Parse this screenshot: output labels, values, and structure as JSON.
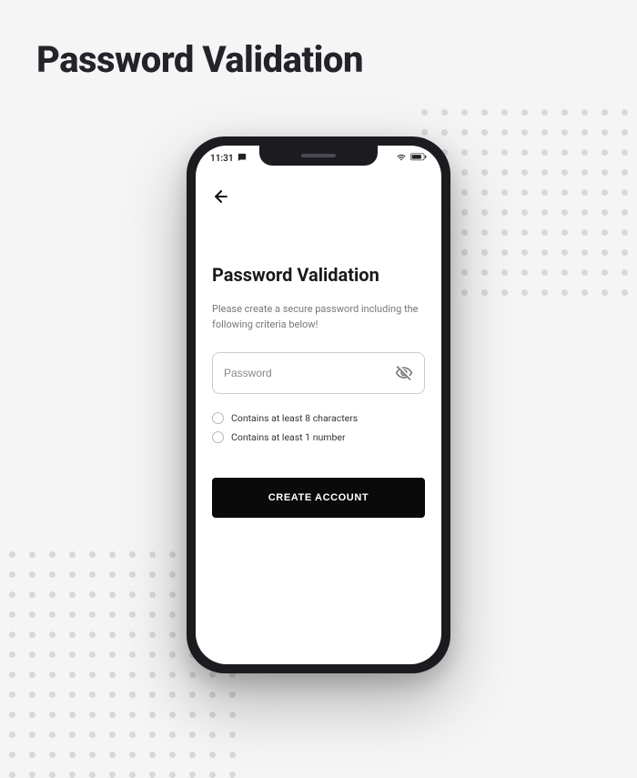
{
  "page": {
    "title": "Password Validation"
  },
  "status_bar": {
    "time": "11:31",
    "sms_icon": "sms"
  },
  "screen": {
    "heading": "Password Validation",
    "subtext": "Please create a secure password including the following criteria below!",
    "password_placeholder": "Password",
    "criteria": [
      "Contains at least 8 characters",
      "Contains at least 1 number"
    ],
    "submit_label": "CREATE ACCOUNT"
  }
}
